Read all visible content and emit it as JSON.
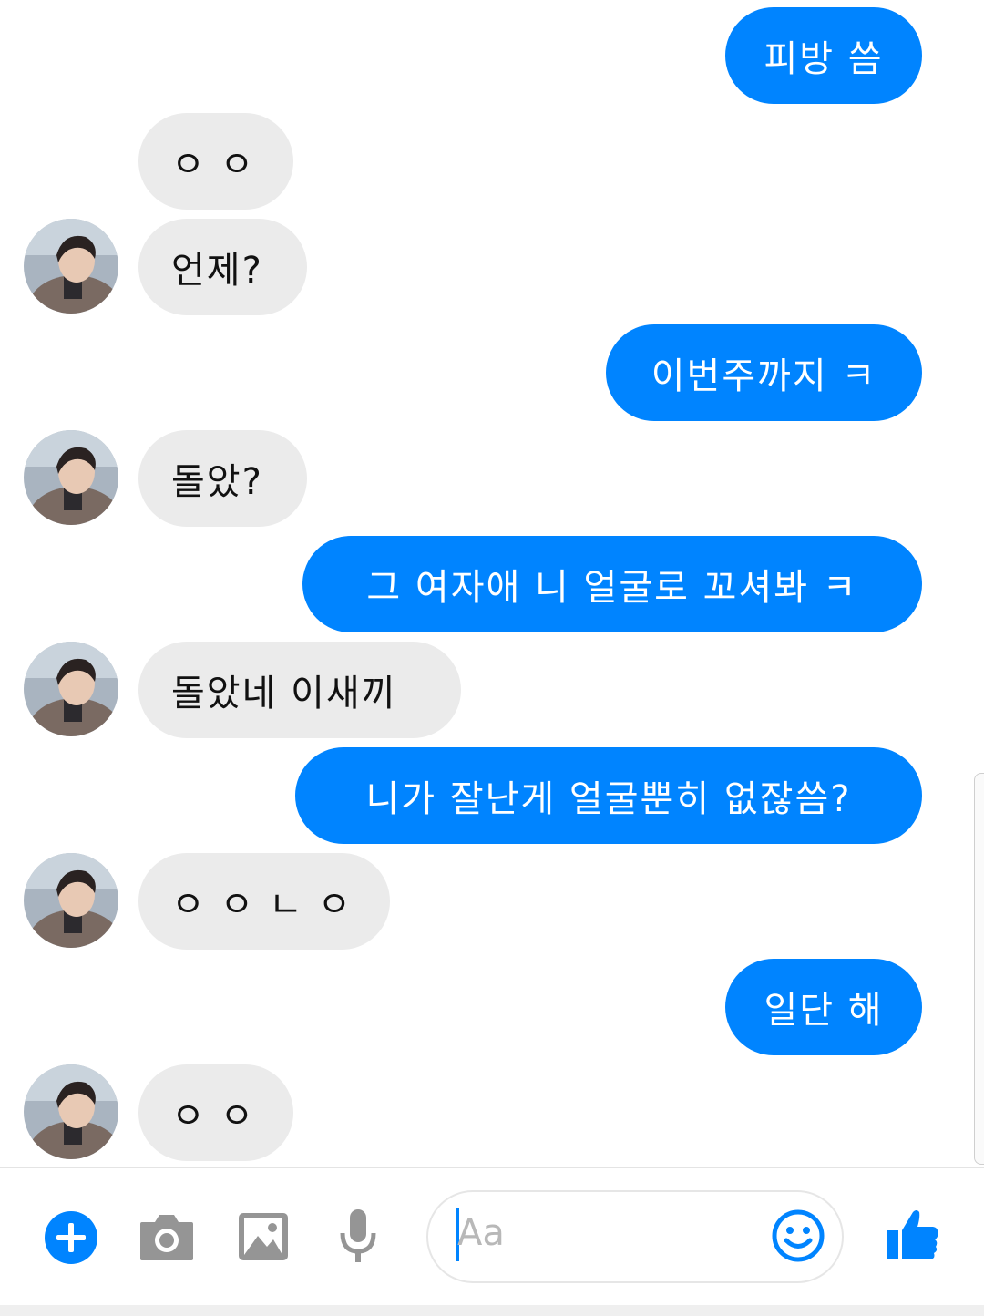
{
  "conversation": {
    "messages": [
      {
        "direction": "outgoing",
        "text": "피방 씀"
      },
      {
        "direction": "incoming",
        "text": "ㅇ ㅇ",
        "avatar": false
      },
      {
        "direction": "incoming",
        "text": "언제?",
        "avatar": true
      },
      {
        "direction": "outgoing",
        "text": "이번주까지 ㅋ"
      },
      {
        "direction": "incoming",
        "text": "돌았?",
        "avatar": true
      },
      {
        "direction": "outgoing",
        "text": "그 여자애 니 얼굴로 꼬셔봐 ㅋ"
      },
      {
        "direction": "incoming",
        "text": "돌았네 이새끼",
        "avatar": true
      },
      {
        "direction": "outgoing",
        "text": "니가 잘난게 얼굴뿐히 없잖씀?"
      },
      {
        "direction": "incoming",
        "text": "ㅇ ㅇ ㄴ ㅇ",
        "avatar": true
      },
      {
        "direction": "outgoing",
        "text": "일단 해"
      },
      {
        "direction": "incoming",
        "text": "ㅇ ㅇ",
        "avatar": true
      }
    ]
  },
  "composer": {
    "placeholder": "Aa",
    "icons": [
      "plus-icon",
      "camera-icon",
      "image-icon",
      "microphone-icon",
      "smiley-icon",
      "thumbs-up-icon"
    ]
  },
  "colors": {
    "outgoing_bubble": "#0084ff",
    "incoming_bubble": "#ebebeb",
    "accent": "#0084ff"
  }
}
